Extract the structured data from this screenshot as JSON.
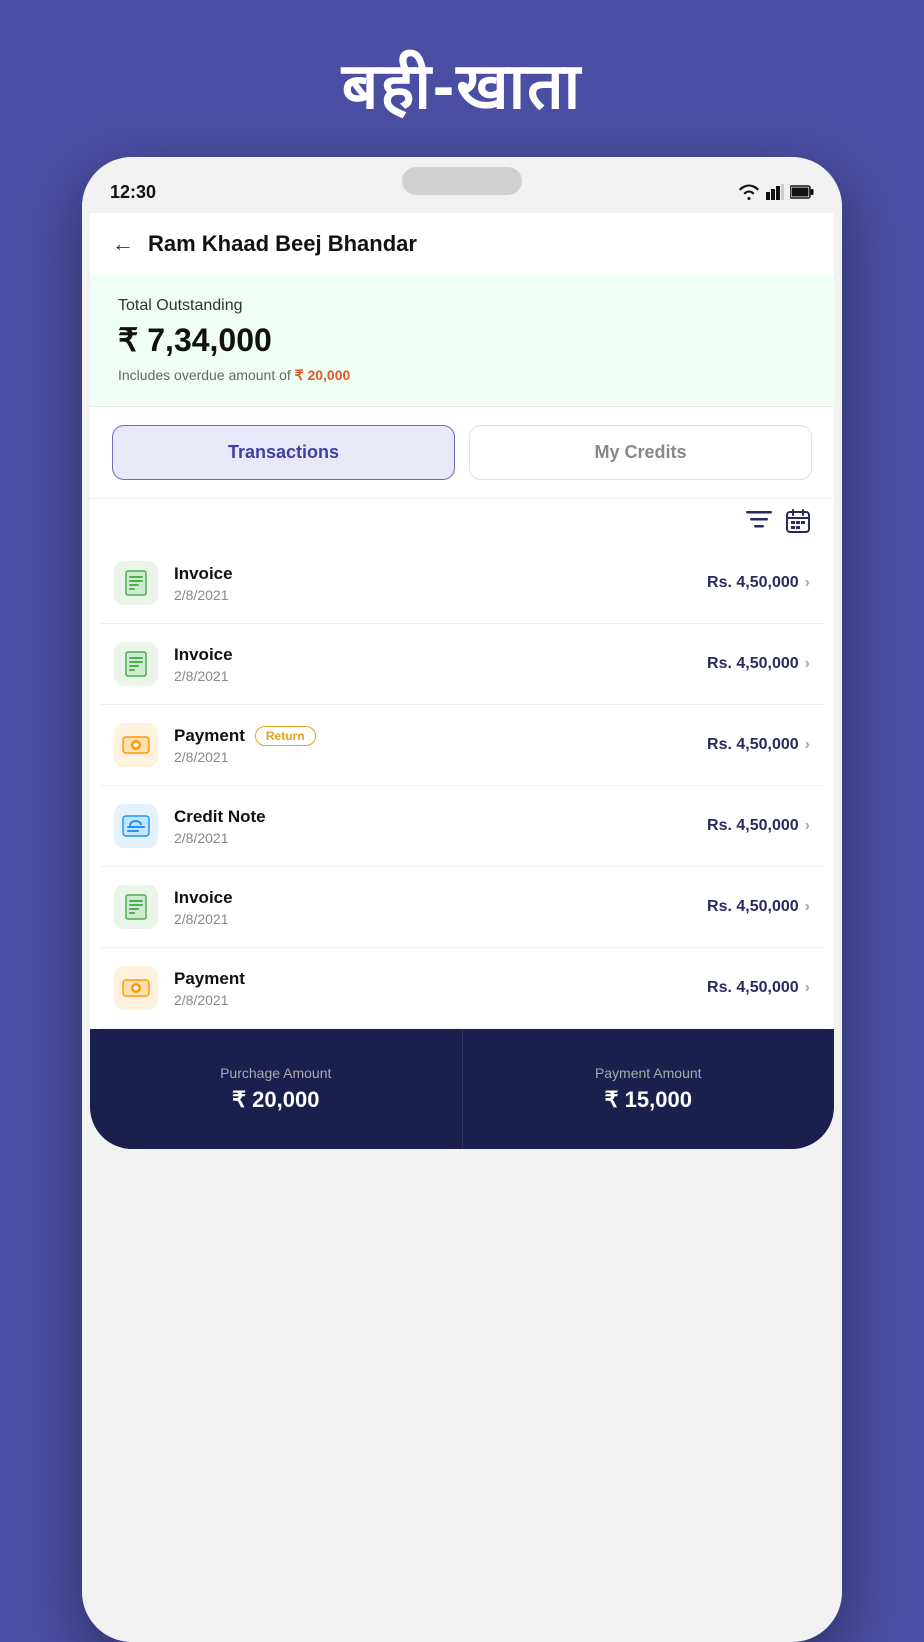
{
  "app": {
    "title": "बही-खाता"
  },
  "status_bar": {
    "time": "12:30"
  },
  "header": {
    "back_label": "←",
    "title": "Ram Khaad Beej Bhandar"
  },
  "outstanding": {
    "label": "Total Outstanding",
    "amount": "₹ 7,34,000",
    "overdue_prefix": "Includes overdue amount of",
    "overdue_amount": "₹ 20,000"
  },
  "tabs": {
    "transactions": "Transactions",
    "my_credits": "My Credits"
  },
  "transactions": [
    {
      "type": "invoice",
      "name": "Invoice",
      "date": "2/8/2021",
      "amount": "Rs. 4,50,000",
      "badge": null
    },
    {
      "type": "invoice",
      "name": "Invoice",
      "date": "2/8/2021",
      "amount": "Rs. 4,50,000",
      "badge": null
    },
    {
      "type": "payment",
      "name": "Payment",
      "date": "2/8/2021",
      "amount": "Rs. 4,50,000",
      "badge": "Return"
    },
    {
      "type": "credit",
      "name": "Credit Note",
      "date": "2/8/2021",
      "amount": "Rs. 4,50,000",
      "badge": null
    },
    {
      "type": "invoice",
      "name": "Invoice",
      "date": "2/8/2021",
      "amount": "Rs. 4,50,000",
      "badge": null
    },
    {
      "type": "payment",
      "name": "Payment",
      "date": "2/8/2021",
      "amount": "Rs. 4,50,000",
      "badge": null
    }
  ],
  "bottom_bar": {
    "purchase_label": "Purchage Amount",
    "purchase_amount": "₹ 20,000",
    "payment_label": "Payment Amount",
    "payment_amount": "₹ 15,000"
  }
}
